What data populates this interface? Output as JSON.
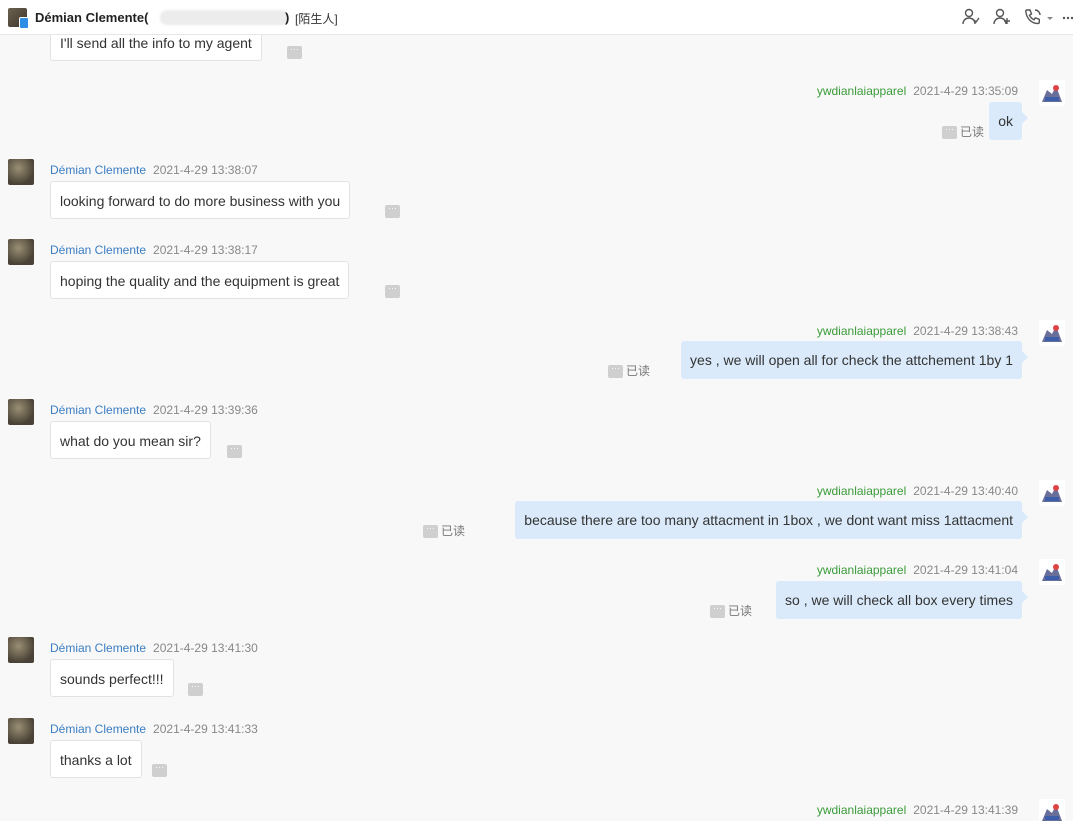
{
  "header": {
    "contact_name": "Démian Clemente(",
    "paren_close": ")",
    "tag": "[陌生人]"
  },
  "chat": {
    "more_glyph": "···",
    "read_label": "已读",
    "messages": [
      {
        "dir": "in",
        "name": "",
        "time": "",
        "text": "I'll send all the info to my agent"
      },
      {
        "dir": "out",
        "name": "ywdianlaiapparel",
        "time": "2021-4-29 13:35:09",
        "text": "ok"
      },
      {
        "dir": "in",
        "name": "Démian Clemente",
        "time": "2021-4-29 13:38:07",
        "text": "looking forward to do more business with you"
      },
      {
        "dir": "in",
        "name": "Démian Clemente",
        "time": "2021-4-29 13:38:17",
        "text": "hoping the quality and the equipment is great"
      },
      {
        "dir": "out",
        "name": "ywdianlaiapparel",
        "time": "2021-4-29 13:38:43",
        "text": "yes , we will open all for check the attchement 1by 1"
      },
      {
        "dir": "in",
        "name": "Démian Clemente",
        "time": "2021-4-29 13:39:36",
        "text": "what do you mean sir?"
      },
      {
        "dir": "out",
        "name": "ywdianlaiapparel",
        "time": "2021-4-29 13:40:40",
        "text": "because there are too many attacment in 1box , we dont want miss 1attacment"
      },
      {
        "dir": "out",
        "name": "ywdianlaiapparel",
        "time": "2021-4-29 13:41:04",
        "text": "so , we will check all box every times"
      },
      {
        "dir": "in",
        "name": "Démian Clemente",
        "time": "2021-4-29 13:41:30",
        "text": "sounds perfect!!!"
      },
      {
        "dir": "in",
        "name": "Démian Clemente",
        "time": "2021-4-29 13:41:33",
        "text": "thanks a lot"
      },
      {
        "dir": "out",
        "name": "ywdianlaiapparel",
        "time": "2021-4-29 13:41:39",
        "text": ""
      }
    ]
  }
}
